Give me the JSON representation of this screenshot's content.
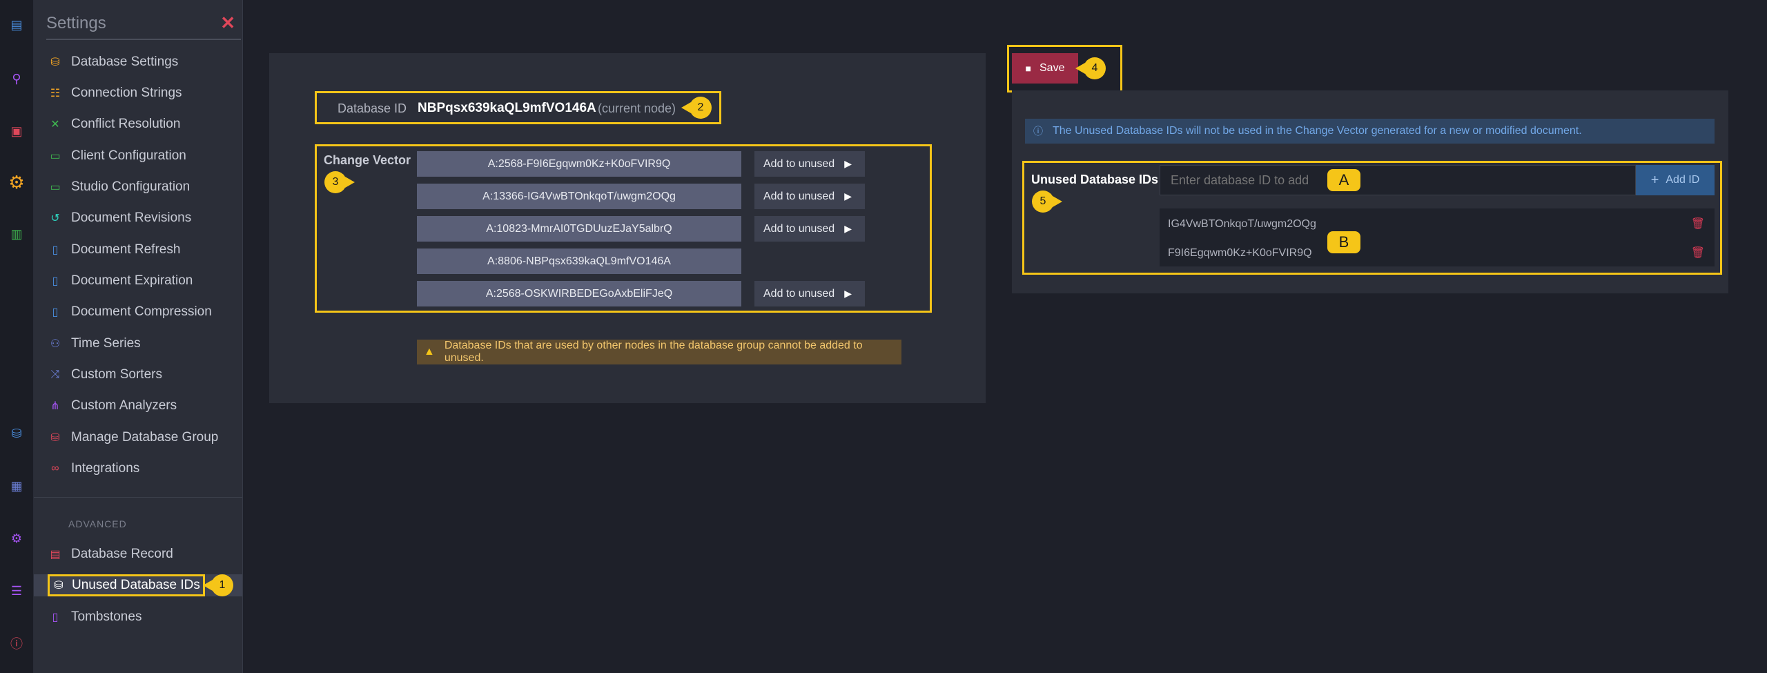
{
  "iconbar": {
    "icons": [
      {
        "name": "documents-icon",
        "color": "#4a90e2"
      },
      {
        "name": "indexes-icon",
        "color": "#a855f7"
      },
      {
        "name": "tasks-icon",
        "color": "#e0475a"
      },
      {
        "name": "settings-icon",
        "color": "#f5a623"
      },
      {
        "name": "stats-icon",
        "color": "#3fb950"
      },
      {
        "name": "databases-icon",
        "color": "#4a90e2"
      },
      {
        "name": "cluster-icon",
        "color": "#6b7fd7"
      },
      {
        "name": "manage-server-icon",
        "color": "#a855f7"
      },
      {
        "name": "server-dashboard-icon",
        "color": "#a855f7"
      },
      {
        "name": "about-icon",
        "color": "#e0475a"
      }
    ]
  },
  "menu": {
    "title": "Settings",
    "close": "✕",
    "items": [
      {
        "label": "Database Settings",
        "icon": "database-settings-icon",
        "color": "#f5a623"
      },
      {
        "label": "Connection Strings",
        "icon": "connection-strings-icon",
        "color": "#f5a623"
      },
      {
        "label": "Conflict Resolution",
        "icon": "conflict-resolution-icon",
        "color": "#3fb950"
      },
      {
        "label": "Client Configuration",
        "icon": "client-configuration-icon",
        "color": "#3fb950"
      },
      {
        "label": "Studio Configuration",
        "icon": "studio-configuration-icon",
        "color": "#3fb950"
      },
      {
        "label": "Document Revisions",
        "icon": "document-revisions-icon",
        "color": "#2dd4bf"
      },
      {
        "label": "Document Refresh",
        "icon": "document-refresh-icon",
        "color": "#4a90e2"
      },
      {
        "label": "Document Expiration",
        "icon": "document-expiration-icon",
        "color": "#4a90e2"
      },
      {
        "label": "Document Compression",
        "icon": "document-compression-icon",
        "color": "#4a90e2"
      },
      {
        "label": "Time Series",
        "icon": "time-series-icon",
        "color": "#6b7fd7"
      },
      {
        "label": "Custom Sorters",
        "icon": "custom-sorters-icon",
        "color": "#6b7fd7"
      },
      {
        "label": "Custom Analyzers",
        "icon": "custom-analyzers-icon",
        "color": "#a855f7"
      },
      {
        "label": "Manage Database Group",
        "icon": "manage-database-group-icon",
        "color": "#e0475a"
      },
      {
        "label": "Integrations",
        "icon": "integrations-icon",
        "color": "#e0475a"
      }
    ],
    "advanced_label": "ADVANCED",
    "advanced_items": [
      {
        "label": "Database Record",
        "icon": "database-record-icon",
        "color": "#e0475a"
      },
      {
        "label": "Unused Database IDs",
        "icon": "unused-database-ids-icon",
        "color": "#ffffff",
        "active": true
      },
      {
        "label": "Tombstones",
        "icon": "tombstones-icon",
        "color": "#a855f7"
      }
    ]
  },
  "callouts": {
    "c1": "1",
    "c2": "2",
    "c3": "3",
    "c4": "4",
    "c5": "5",
    "cA": "A",
    "cB": "B"
  },
  "database_id": {
    "label": "Database ID",
    "value": "NBPqsx639kaQL9mfVO146A",
    "note": "(current node)"
  },
  "change_vector": {
    "label": "Change Vector",
    "entries": [
      {
        "value": "A:2568-F9I6Egqwm0Kz+K0oFVIR9Q",
        "button": "Add to unused"
      },
      {
        "value": "A:13366-IG4VwBTOnkqoT/uwgm2OQg",
        "button": "Add to unused"
      },
      {
        "value": "A:10823-MmrAI0TGDUuzEJaY5albrQ",
        "button": "Add to unused"
      },
      {
        "value": "A:8806-NBPqsx639kaQL9mfVO146A",
        "button": ""
      },
      {
        "value": "A:2568-OSKWIRBEDEGoAxbEliFJeQ",
        "button": "Add to unused"
      }
    ]
  },
  "warning": "Database IDs that are used by other nodes in the database group cannot be added to unused.",
  "save": {
    "label": "Save"
  },
  "info": "The Unused Database IDs will not be used in the Change Vector generated for a new or modified document.",
  "unused_ids": {
    "label": "Unused Database IDs",
    "input_placeholder": "Enter database ID to add",
    "add_label": "Add ID",
    "items": [
      "IG4VwBTOnkqoT/uwgm2OQg",
      "F9I6Egqwm0Kz+K0oFVIR9Q"
    ]
  }
}
